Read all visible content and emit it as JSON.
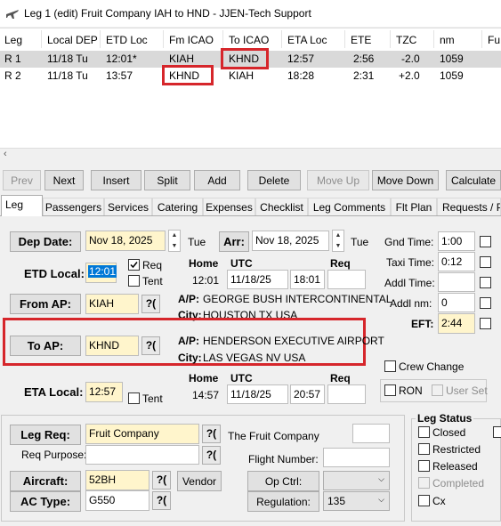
{
  "window": {
    "title": "Leg 1 (edit) Fruit Company IAH to HND - JJEN-Tech Support"
  },
  "grid": {
    "headers": [
      "Leg",
      "Local DEP",
      "ETD Loc",
      "Fm ICAO",
      "To ICAO",
      "ETA Loc",
      "ETE",
      "TZC",
      "nm",
      "Fu"
    ],
    "rows": [
      [
        "R 1",
        "11/18 Tu",
        "12:01*",
        "KIAH",
        "KHND",
        "12:57",
        "2:56",
        "-2.0",
        "1059",
        ""
      ],
      [
        "R 2",
        "11/18 Tu",
        "13:57",
        "KHND",
        "KIAH",
        "18:28",
        "2:31",
        "+2.0",
        "1059",
        ""
      ]
    ]
  },
  "toolbar": {
    "prev": "Prev",
    "next": "Next",
    "insert": "Insert",
    "split": "Split",
    "add": "Add",
    "delete": "Delete",
    "move_up": "Move Up",
    "move_down": "Move Down",
    "calculate": "Calculate"
  },
  "tabs": [
    "Leg",
    "Passengers",
    "Services",
    "Catering",
    "Expenses",
    "Checklist",
    "Leg Comments",
    "Flt Plan",
    "Requests / P"
  ],
  "leg": {
    "dep_date_label": "Dep Date:",
    "dep_date": "Nov 18, 2025",
    "dep_day": "Tue",
    "arr_label": "Arr:",
    "arr_date": "Nov 18, 2025",
    "arr_day": "Tue",
    "etd_local_label": "ETD Local:",
    "etd_local": "12:01",
    "req_label": "Req",
    "tent_label": "Tent",
    "home_label": "Home",
    "utc_label": "UTC",
    "req_col_label": "Req",
    "dep_home": "12:01",
    "dep_utc_date": "11/18/25",
    "dep_utc_time": "18:01",
    "from_ap_label": "From AP:",
    "from_ap": "KIAH",
    "from_ap_name_label": "A/P:",
    "from_ap_name": "GEORGE BUSH INTERCONTINENTAL",
    "from_city_label": "City:",
    "from_city": "HOUSTON TX USA",
    "to_ap_label": "To AP:",
    "to_ap": "KHND",
    "to_ap_name_label": "A/P:",
    "to_ap_name": "HENDERSON EXECUTIVE AIRPORT",
    "to_city_label": "City:",
    "to_city": "LAS VEGAS NV USA",
    "eta_local_label": "ETA Local:",
    "eta_local": "12:57",
    "eta_tent_label": "Tent",
    "arr_home": "14:57",
    "arr_utc_date": "11/18/25",
    "arr_utc_time": "20:57",
    "qmark": "?("
  },
  "times": {
    "gnd_label": "Gnd Time:",
    "gnd": "1:00",
    "taxi_label": "Taxi Time:",
    "taxi": "0:12",
    "addl_time_label": "Addl Time:",
    "addl_time": "",
    "addl_nm_label": "Addl nm:",
    "addl_nm": "0",
    "eft_label": "EFT:",
    "eft": "2:44",
    "crew_change_label": "Crew Change",
    "ron_label": "RON",
    "user_set_label": "User Set"
  },
  "lower": {
    "leg_req_label": "Leg Req:",
    "leg_req": "Fruit Company",
    "leg_req_name": "The Fruit Company",
    "req_purpose_label": "Req Purpose:",
    "flight_number_label": "Flight Number:",
    "aircraft_label": "Aircraft:",
    "aircraft": "52BH",
    "vendor_label": "Vendor",
    "op_ctrl_label": "Op Ctrl:",
    "ac_type_label": "AC Type:",
    "ac_type": "G550",
    "regulation_label": "Regulation:",
    "regulation": "135"
  },
  "leg_status": {
    "title": "Leg Status",
    "items": [
      "Closed",
      "Restricted",
      "Released",
      "Completed",
      "Cx"
    ]
  },
  "colors": {
    "highlight_red": "#d6262b",
    "required_yellow": "#fff5cc",
    "selection_blue": "#0078d7"
  }
}
